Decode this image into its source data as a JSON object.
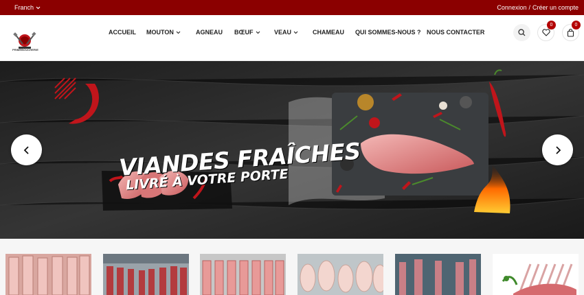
{
  "topbar": {
    "language": "Franch",
    "login": "Connexion",
    "separator": "/",
    "register": "Créer un compte"
  },
  "brand": {
    "name": "PRIMEBOUCHERIE"
  },
  "nav": [
    {
      "label": "ACCUEIL",
      "dropdown": false
    },
    {
      "label": "MOUTON",
      "dropdown": true
    },
    {
      "label": "AGNEAU",
      "dropdown": false
    },
    {
      "label": "BŒUF",
      "dropdown": true
    },
    {
      "label": "VEAU",
      "dropdown": true
    },
    {
      "label": "CHAMEAU",
      "dropdown": false
    },
    {
      "label": "QUI SOMMES-NOUS ?",
      "dropdown": false
    },
    {
      "label": "NOUS CONTACTER",
      "dropdown": false
    }
  ],
  "header_icons": {
    "search": "search-icon",
    "wishlist": "heart-icon",
    "wishlist_count": "0",
    "cart": "bag-icon",
    "cart_count": "0"
  },
  "hero": {
    "line1": "VIANDES FRAÎCHES",
    "line2": "LIVRÉ À VOTRE PORTE"
  },
  "colors": {
    "topbar": "#8b0000",
    "accent": "#c0151b",
    "badge": "#b30000"
  },
  "categories": [
    {
      "name": "lamb-carcasses"
    },
    {
      "name": "beef-hall"
    },
    {
      "name": "sheep-carcasses"
    },
    {
      "name": "poultry-carcasses"
    },
    {
      "name": "cold-room"
    },
    {
      "name": "lamb-rack"
    }
  ]
}
